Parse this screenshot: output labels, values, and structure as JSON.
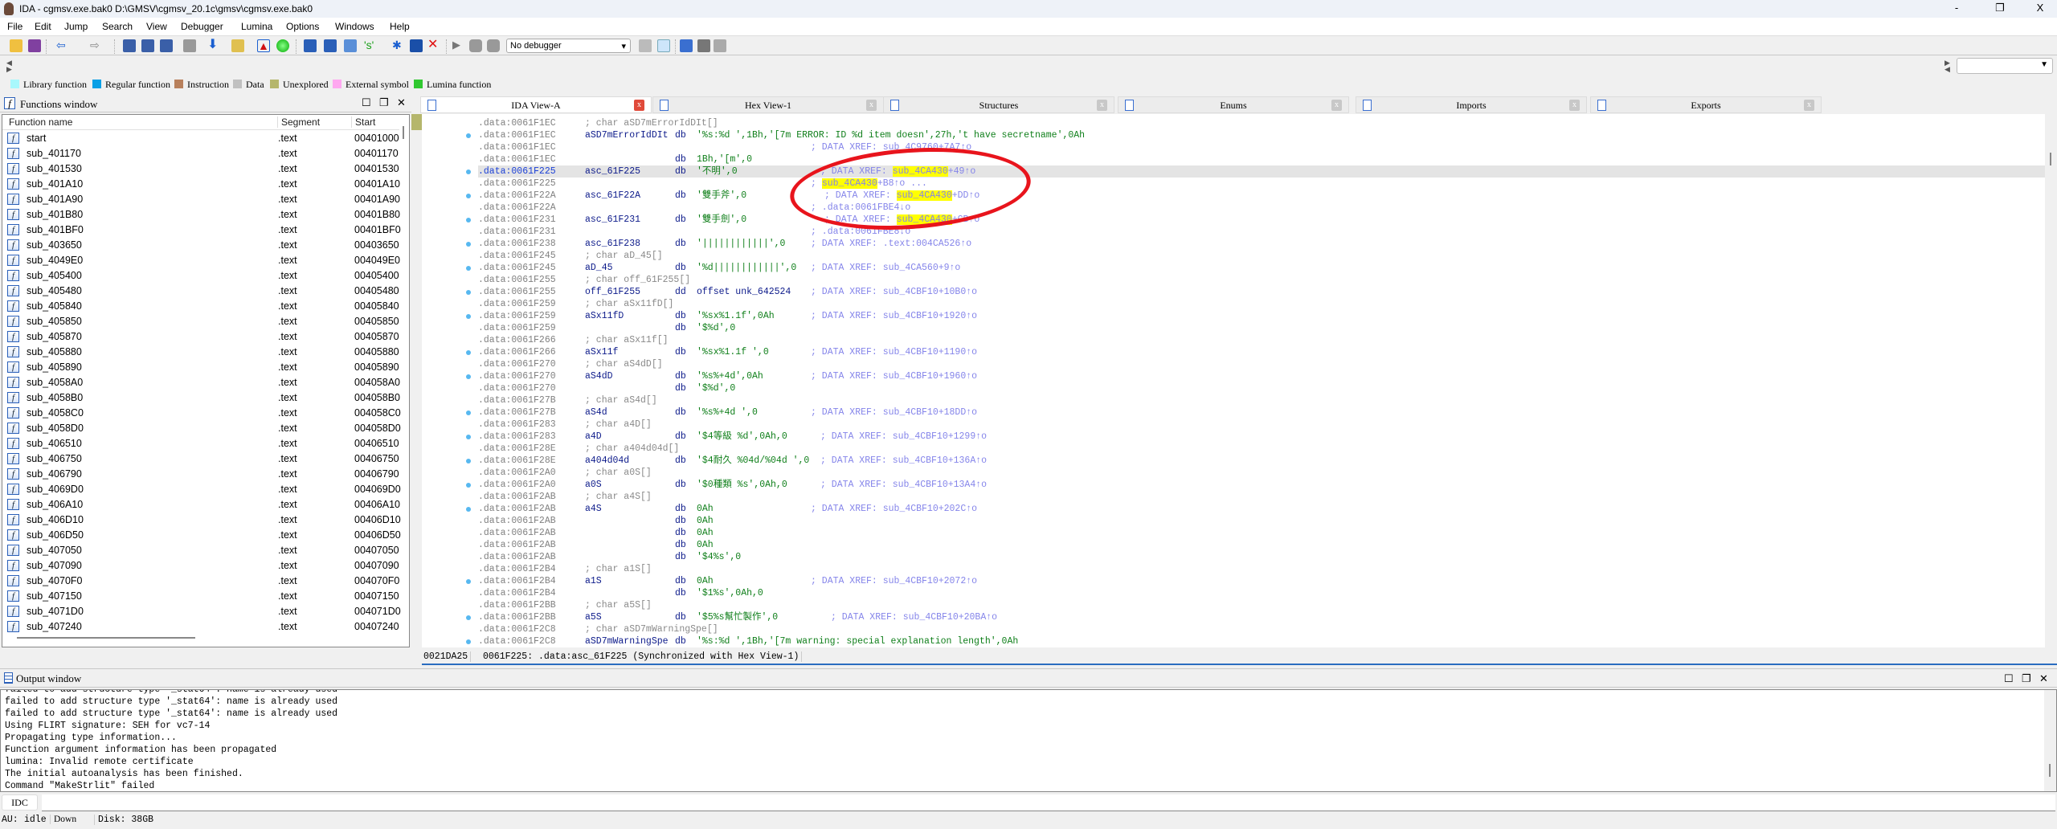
{
  "window": {
    "title": "IDA - cgmsv.exe.bak0 D:\\GMSV\\cgmsv_20.1c\\gmsv\\cgmsv.exe.bak0",
    "minimize": "-",
    "restore": "❐",
    "close": "X"
  },
  "menu": [
    "File",
    "Edit",
    "Jump",
    "Search",
    "View",
    "Debugger",
    "Lumina",
    "Options",
    "Windows",
    "Help"
  ],
  "toolbar": {
    "debugger_select": "No debugger",
    "nav_dropdown": ""
  },
  "legend": [
    {
      "label": "Library function",
      "color": "#a8f8fc"
    },
    {
      "label": "Regular function",
      "color": "#0aa0e6"
    },
    {
      "label": "Instruction",
      "color": "#b8805c"
    },
    {
      "label": "Data",
      "color": "#c0c0c0"
    },
    {
      "label": "Unexplored",
      "color": "#b5b66c"
    },
    {
      "label": "External symbol",
      "color": "#ffa8f0"
    },
    {
      "label": "Lumina function",
      "color": "#30c830"
    }
  ],
  "functions": {
    "title": "Functions window",
    "columns": [
      "Function name",
      "Segment",
      "Start"
    ],
    "rows": [
      [
        "start",
        ".text",
        "00401000"
      ],
      [
        "sub_401170",
        ".text",
        "00401170"
      ],
      [
        "sub_401530",
        ".text",
        "00401530"
      ],
      [
        "sub_401A10",
        ".text",
        "00401A10"
      ],
      [
        "sub_401A90",
        ".text",
        "00401A90"
      ],
      [
        "sub_401B80",
        ".text",
        "00401B80"
      ],
      [
        "sub_401BF0",
        ".text",
        "00401BF0"
      ],
      [
        "sub_403650",
        ".text",
        "00403650"
      ],
      [
        "sub_4049E0",
        ".text",
        "004049E0"
      ],
      [
        "sub_405400",
        ".text",
        "00405400"
      ],
      [
        "sub_405480",
        ".text",
        "00405480"
      ],
      [
        "sub_405840",
        ".text",
        "00405840"
      ],
      [
        "sub_405850",
        ".text",
        "00405850"
      ],
      [
        "sub_405870",
        ".text",
        "00405870"
      ],
      [
        "sub_405880",
        ".text",
        "00405880"
      ],
      [
        "sub_405890",
        ".text",
        "00405890"
      ],
      [
        "sub_4058A0",
        ".text",
        "004058A0"
      ],
      [
        "sub_4058B0",
        ".text",
        "004058B0"
      ],
      [
        "sub_4058C0",
        ".text",
        "004058C0"
      ],
      [
        "sub_4058D0",
        ".text",
        "004058D0"
      ],
      [
        "sub_406510",
        ".text",
        "00406510"
      ],
      [
        "sub_406750",
        ".text",
        "00406750"
      ],
      [
        "sub_406790",
        ".text",
        "00406790"
      ],
      [
        "sub_4069D0",
        ".text",
        "004069D0"
      ],
      [
        "sub_406A10",
        ".text",
        "00406A10"
      ],
      [
        "sub_406D10",
        ".text",
        "00406D10"
      ],
      [
        "sub_406D50",
        ".text",
        "00406D50"
      ],
      [
        "sub_407050",
        ".text",
        "00407050"
      ],
      [
        "sub_407090",
        ".text",
        "00407090"
      ],
      [
        "sub_4070F0",
        ".text",
        "004070F0"
      ],
      [
        "sub_407150",
        ".text",
        "00407150"
      ],
      [
        "sub_4071D0",
        ".text",
        "004071D0"
      ],
      [
        "sub_407240",
        ".text",
        "00407240"
      ]
    ]
  },
  "tabs": [
    {
      "label": "IDA View-A",
      "active": true
    },
    {
      "label": "Hex View-1"
    },
    {
      "label": "Structures"
    },
    {
      "label": "Enums"
    },
    {
      "label": "Imports"
    },
    {
      "label": "Exports"
    }
  ],
  "code": {
    "lines": [
      {
        "addr": ".data:0061F1EC",
        "decl": "; char aSD7mErrorIdDIt[]"
      },
      {
        "addr": ".data:0061F1EC",
        "label": "aSD7mErrorIdDIt",
        "op": "db",
        "arg": "'%s:%d ',1Bh,'[7m ERROR: ID %d item doesn',27h,'t have secretname',0Ah",
        "dot": true
      },
      {
        "addr": ".data:0061F1EC",
        "cmt": [
          {
            "t": "; DATA XREF: sub_4C9760+7A7↑o"
          }
        ]
      },
      {
        "addr": ".data:0061F1EC",
        "op": "db",
        "arg": "1Bh,'[m',0"
      },
      {
        "addr": ".data:0061F225",
        "label": "asc_61F225",
        "op": "db",
        "arg": "'不明',0",
        "dot": true,
        "selected": true,
        "cmt": [
          {
            "t": "; DATA XREF: "
          },
          {
            "t": "sub_4CA430",
            "hl": true
          },
          {
            "t": "+49↑o"
          }
        ]
      },
      {
        "addr": ".data:0061F225",
        "cmt": [
          {
            "t": "; "
          },
          {
            "t": "sub_4CA430",
            "hl": true
          },
          {
            "t": "+B8↑o ..."
          }
        ]
      },
      {
        "addr": ".data:0061F22A",
        "label": "asc_61F22A",
        "op": "db",
        "arg": "'雙手斧',0",
        "dot": true,
        "cmt": [
          {
            "t": "; DATA XREF: "
          },
          {
            "t": "sub_4CA430",
            "hl": true
          },
          {
            "t": "+DD↑o"
          }
        ]
      },
      {
        "addr": ".data:0061F22A",
        "cmt": [
          {
            "t": "; .data:0061FBE4↓o"
          }
        ]
      },
      {
        "addr": ".data:0061F231",
        "label": "asc_61F231",
        "op": "db",
        "arg": "'雙手劍',0",
        "dot": true,
        "cmt": [
          {
            "t": "; DATA XREF: "
          },
          {
            "t": "sub_4CA430",
            "hl": true
          },
          {
            "t": "+CB↑o"
          }
        ]
      },
      {
        "addr": ".data:0061F231",
        "cmt": [
          {
            "t": "; .data:0061FBE8↓o"
          }
        ]
      },
      {
        "addr": ".data:0061F238",
        "label": "asc_61F238",
        "op": "db",
        "arg": "'||||||||||||',0",
        "dot": true,
        "cmt": [
          {
            "t": "; DATA XREF: .text:004CA526↑o"
          }
        ]
      },
      {
        "addr": ".data:0061F245",
        "decl": "; char aD_45[]"
      },
      {
        "addr": ".data:0061F245",
        "label": "aD_45",
        "op": "db",
        "arg": "'%d||||||||||||',0",
        "dot": true,
        "cmt": [
          {
            "t": "; DATA XREF: sub_4CA560+9↑o"
          }
        ]
      },
      {
        "addr": ".data:0061F255",
        "decl": "; char off_61F255[]"
      },
      {
        "addr": ".data:0061F255",
        "label": "off_61F255",
        "op": "dd",
        "arg": "offset unk_642524",
        "ref": true,
        "dot": true,
        "cmt": [
          {
            "t": "; DATA XREF: sub_4CBF10+10B0↑o"
          }
        ]
      },
      {
        "addr": ".data:0061F259",
        "decl": "; char aSx11fD[]"
      },
      {
        "addr": ".data:0061F259",
        "label": "aSx11fD",
        "op": "db",
        "arg": "'%sx%1.1f',0Ah",
        "dot": true,
        "cmt": [
          {
            "t": "; DATA XREF: sub_4CBF10+1920↑o"
          }
        ]
      },
      {
        "addr": ".data:0061F259",
        "op": "db",
        "arg": "'$%d',0"
      },
      {
        "addr": ".data:0061F266",
        "decl": "; char aSx11f[]"
      },
      {
        "addr": ".data:0061F266",
        "label": "aSx11f",
        "op": "db",
        "arg": "'%sx%1.1f ',0",
        "dot": true,
        "cmt": [
          {
            "t": "; DATA XREF: sub_4CBF10+1190↑o"
          }
        ]
      },
      {
        "addr": ".data:0061F270",
        "decl": "; char aS4dD[]"
      },
      {
        "addr": ".data:0061F270",
        "label": "aS4dD",
        "op": "db",
        "arg": "'%s%+4d',0Ah",
        "dot": true,
        "cmt": [
          {
            "t": "; DATA XREF: sub_4CBF10+1960↑o"
          }
        ]
      },
      {
        "addr": ".data:0061F270",
        "op": "db",
        "arg": "'$%d',0"
      },
      {
        "addr": ".data:0061F27B",
        "decl": "; char aS4d[]"
      },
      {
        "addr": ".data:0061F27B",
        "label": "aS4d",
        "op": "db",
        "arg": "'%s%+4d ',0",
        "dot": true,
        "cmt": [
          {
            "t": "; DATA XREF: sub_4CBF10+18DD↑o"
          }
        ]
      },
      {
        "addr": ".data:0061F283",
        "decl": "; char a4D[]"
      },
      {
        "addr": ".data:0061F283",
        "label": "a4D",
        "op": "db",
        "arg": "'$4等級 %d',0Ah,0",
        "dot": true,
        "cmt": [
          {
            "t": "; DATA XREF: sub_4CBF10+1299↑o"
          }
        ]
      },
      {
        "addr": ".data:0061F28E",
        "decl": "; char a404d04d[]"
      },
      {
        "addr": ".data:0061F28E",
        "label": "a404d04d",
        "op": "db",
        "arg": "'$4耐久 %04d/%04d ',0",
        "dot": true,
        "cmt": [
          {
            "t": "; DATA XREF: sub_4CBF10+136A↑o"
          }
        ]
      },
      {
        "addr": ".data:0061F2A0",
        "decl": "; char a0S[]"
      },
      {
        "addr": ".data:0061F2A0",
        "label": "a0S",
        "op": "db",
        "arg": "'$0種類 %s',0Ah,0",
        "dot": true,
        "cmt": [
          {
            "t": "; DATA XREF: sub_4CBF10+13A4↑o"
          }
        ]
      },
      {
        "addr": ".data:0061F2AB",
        "decl": "; char a4S[]"
      },
      {
        "addr": ".data:0061F2AB",
        "label": "a4S",
        "op": "db",
        "arg": "0Ah",
        "dot": true,
        "cmt": [
          {
            "t": "; DATA XREF: sub_4CBF10+202C↑o"
          }
        ]
      },
      {
        "addr": ".data:0061F2AB",
        "op": "db",
        "arg": "0Ah"
      },
      {
        "addr": ".data:0061F2AB",
        "op": "db",
        "arg": "0Ah"
      },
      {
        "addr": ".data:0061F2AB",
        "op": "db",
        "arg": "0Ah"
      },
      {
        "addr": ".data:0061F2AB",
        "op": "db",
        "arg": "'$4%s',0"
      },
      {
        "addr": ".data:0061F2B4",
        "decl": "; char a1S[]"
      },
      {
        "addr": ".data:0061F2B4",
        "label": "a1S",
        "op": "db",
        "arg": "0Ah",
        "dot": true,
        "cmt": [
          {
            "t": "; DATA XREF: sub_4CBF10+2072↑o"
          }
        ]
      },
      {
        "addr": ".data:0061F2B4",
        "op": "db",
        "arg": "'$1%s',0Ah,0"
      },
      {
        "addr": ".data:0061F2BB",
        "decl": "; char a5S[]"
      },
      {
        "addr": ".data:0061F2BB",
        "label": "a5S",
        "op": "db",
        "arg": "'$5%s幫忙製作',0",
        "dot": true,
        "cmt": [
          {
            "t": "; DATA XREF: sub_4CBF10+20BA↑o"
          }
        ]
      },
      {
        "addr": ".data:0061F2C8",
        "decl": "; char aSD7mWarningSpe[]"
      },
      {
        "addr": ".data:0061F2C8",
        "label": "aSD7mWarningSpe",
        "op": "db",
        "arg": "'%s:%d ',1Bh,'[7m warning: special explanation length',0Ah",
        "dot": true
      }
    ],
    "status": {
      "offset": "0021DA25",
      "location": "0061F225: .data:asc_61F225 (Synchronized with Hex View-1)"
    }
  },
  "output": {
    "title": "Output window",
    "lines": [
      "failed to add structure type '_stat64': name is already used",
      "failed to add structure type '_stat64': name is already used",
      "failed to add structure type '_stat64': name is already used",
      "Using FLIRT signature: SEH for vc7-14",
      "Propagating type information...",
      "Function argument information has been propagated",
      "lumina: Invalid remote certificate",
      "The initial autoanalysis has been finished.",
      "Command \"MakeStrlit\" failed"
    ],
    "idc_button": "IDC",
    "idc_input": ""
  },
  "statusbar": {
    "au": "AU:",
    "state": "idle",
    "direction": "Down",
    "disk": "Disk: 38GB"
  },
  "annotation": {
    "shape": "red-ellipse",
    "color": "#e8141c"
  }
}
